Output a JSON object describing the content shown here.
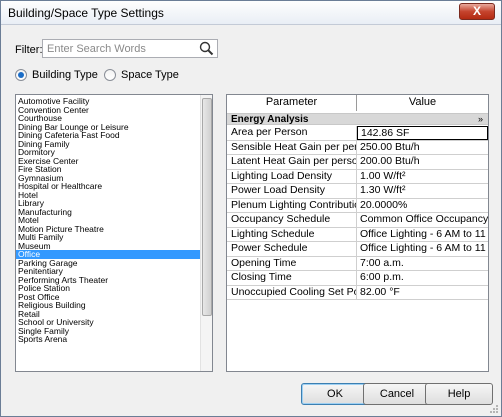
{
  "window": {
    "title": "Building/Space Type Settings",
    "close_label": "X"
  },
  "filter": {
    "label": "Filter:",
    "placeholder": "Enter Search Words"
  },
  "radios": {
    "building_type": "Building Type",
    "space_type": "Space Type"
  },
  "type_list": {
    "selected_index": 21,
    "items": [
      "Automotive Facility",
      "Convention Center",
      "Courthouse",
      "Dining Bar Lounge or Leisure",
      "Dining Cafeteria Fast Food",
      "Dining Family",
      "Dormitory",
      "Exercise Center",
      "Fire Station",
      "Gymnasium",
      "Hospital or Healthcare",
      "Hotel",
      "Library",
      "Manufacturing",
      "Motel",
      "Motion Picture Theatre",
      "Multi Family",
      "Museum",
      "Office",
      "Parking Garage",
      "Penitentiary",
      "Performing Arts Theater",
      "Police Station",
      "Post Office",
      "Religious Building",
      "Retail",
      "School or University",
      "Single Family",
      "Sports Arena"
    ]
  },
  "grid": {
    "headers": {
      "parameter": "Parameter",
      "value": "Value"
    },
    "group_title": "Energy Analysis",
    "collapse_glyph": "»",
    "rows": [
      {
        "p": "Area per Person",
        "v": "142.86 SF"
      },
      {
        "p": "Sensible Heat Gain per person",
        "v": "250.00 Btu/h"
      },
      {
        "p": "Latent Heat Gain per person",
        "v": "200.00 Btu/h"
      },
      {
        "p": "Lighting Load Density",
        "v": "1.00 W/ft²"
      },
      {
        "p": "Power Load Density",
        "v": "1.30 W/ft²"
      },
      {
        "p": "Plenum Lighting Contribution",
        "v": "20.0000%"
      },
      {
        "p": "Occupancy Schedule",
        "v": "Common Office Occupancy -"
      },
      {
        "p": "Lighting Schedule",
        "v": "Office Lighting - 6 AM to 11 P"
      },
      {
        "p": "Power Schedule",
        "v": "Office Lighting - 6 AM to 11 P"
      },
      {
        "p": "Opening Time",
        "v": "7:00 a.m."
      },
      {
        "p": "Closing Time",
        "v": "6:00 p.m."
      },
      {
        "p": "Unoccupied Cooling Set Point",
        "v": "82.00 °F"
      }
    ]
  },
  "buttons": {
    "ok": "OK",
    "cancel": "Cancel",
    "help": "Help"
  }
}
